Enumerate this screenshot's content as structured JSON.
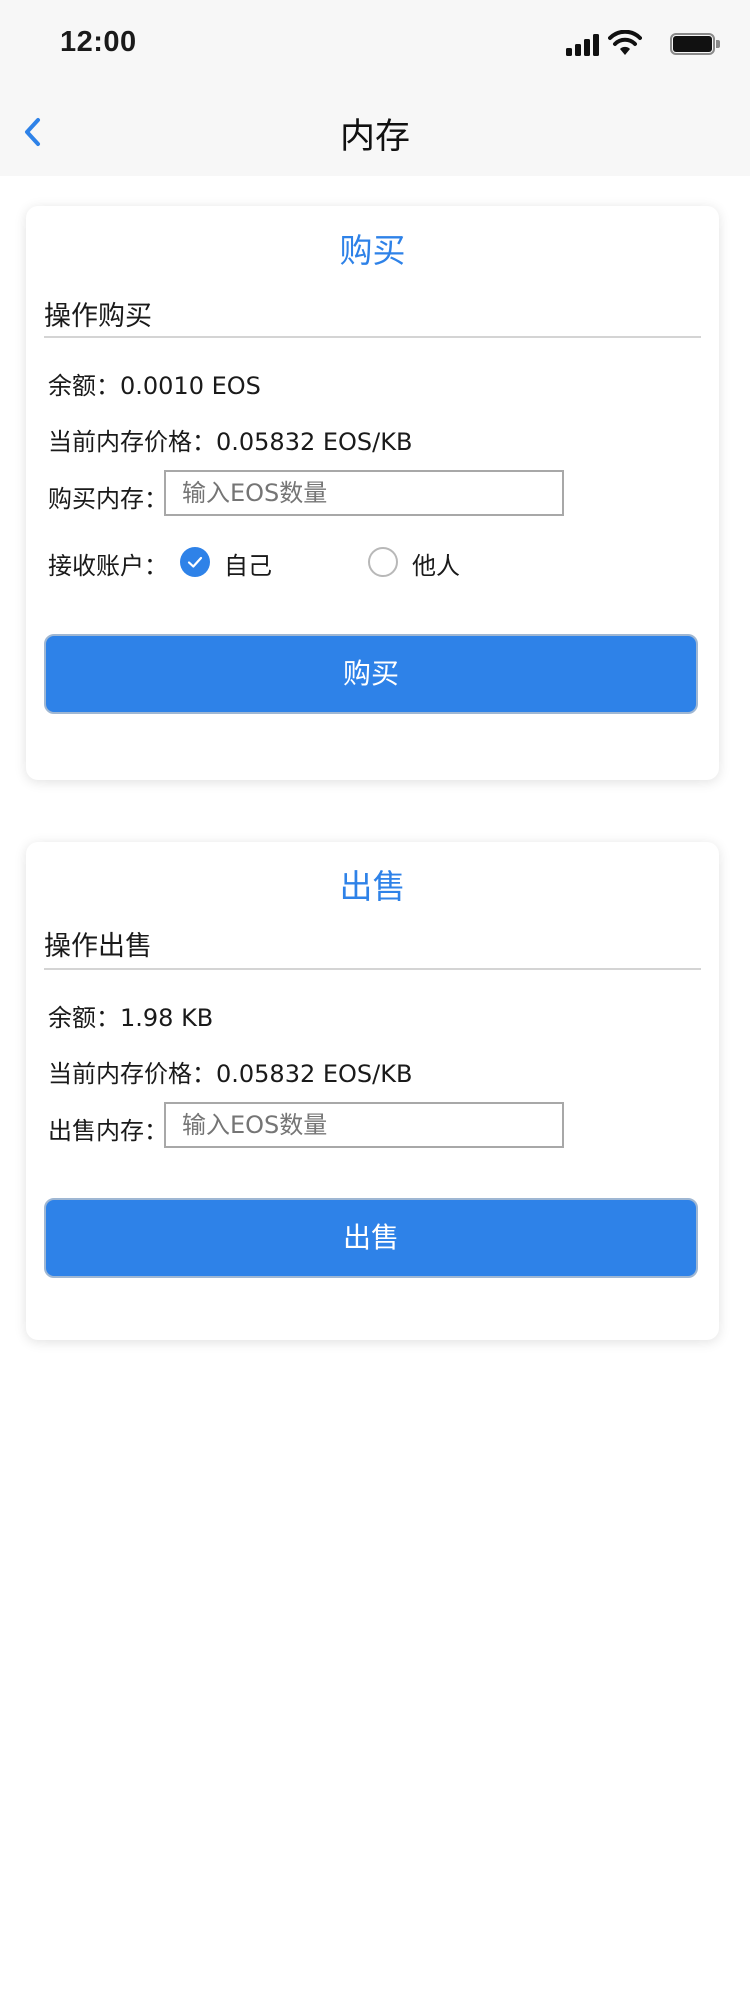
{
  "status_bar": {
    "time": "12:00"
  },
  "nav": {
    "title": "内存",
    "back_icon": "chevron-left-icon"
  },
  "colors": {
    "accent": "#2e82e8",
    "button": "#2e82e8"
  },
  "buy": {
    "title": "购买",
    "subtitle": "操作购买",
    "balance": "余额：0.0010 EOS",
    "price": "当前内存价格：0.05832 EOS/KB",
    "amount_label": "购买内存：",
    "amount_placeholder": "输入EOS数量",
    "amount_value": "",
    "receiver_label": "接收账户：",
    "receiver_options": [
      {
        "label": "自己",
        "selected": true
      },
      {
        "label": "他人",
        "selected": false
      }
    ],
    "button": "购买"
  },
  "sell": {
    "title": "出售",
    "subtitle": "操作出售",
    "balance": "余额：1.98 KB",
    "price": "当前内存价格：0.05832 EOS/KB",
    "amount_label": "出售内存：",
    "amount_placeholder": "输入EOS数量",
    "amount_value": "",
    "button": "出售"
  }
}
